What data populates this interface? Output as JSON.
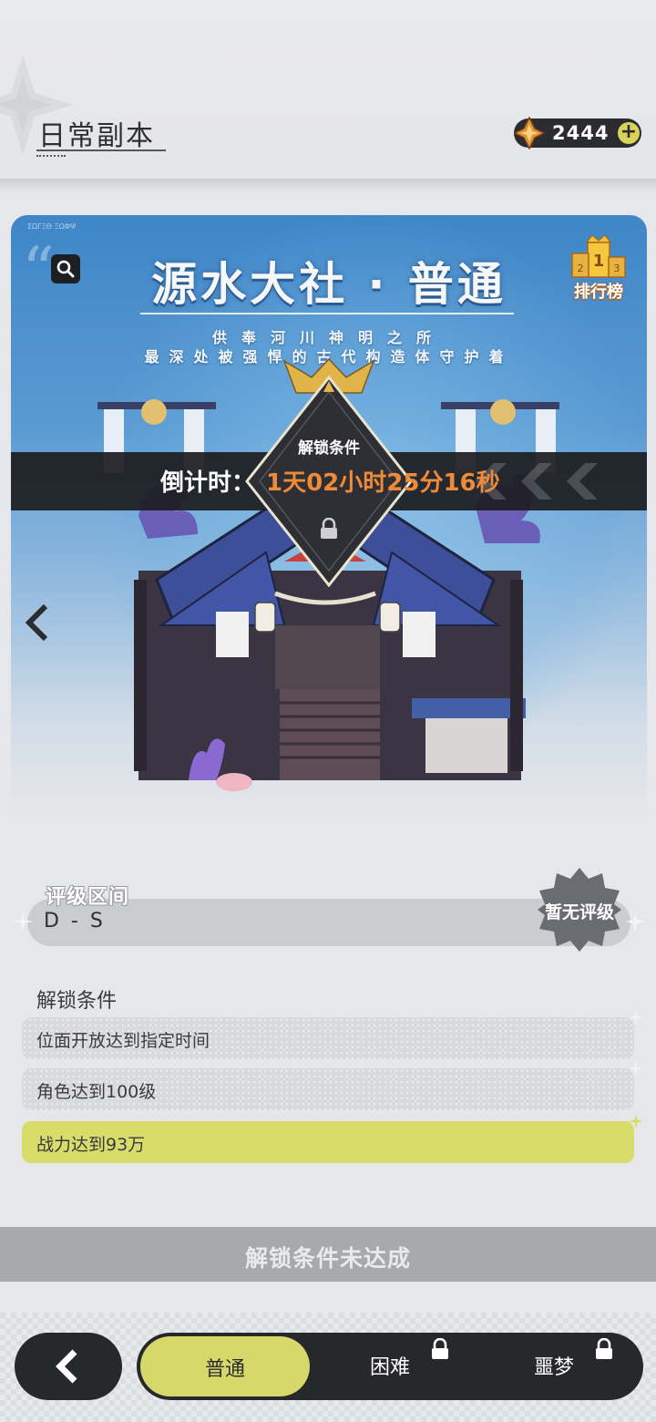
{
  "header": {
    "title": "日常副本",
    "currency": {
      "value": "2444",
      "icon": "crystal-icon",
      "add_icon": "plus-icon"
    }
  },
  "stage": {
    "title": "源水大社 · 普通",
    "subtitle_line1": "供奉河川神明之所",
    "subtitle_line2": "最深处被强悍的古代构造体守护着",
    "corner_mark": "ΣΩΓΞΘ ΞΩΦΨ",
    "ranking_label": "排行榜",
    "unlock_tag": "解锁条件",
    "countdown_label": "倒计时：",
    "countdown_value": "1天02小时25分16秒"
  },
  "rating": {
    "label": "评级区间",
    "range": "D - S",
    "badge": "暂无评级"
  },
  "unlock": {
    "heading": "解锁条件",
    "conditions": [
      {
        "text": "位面开放达到指定时间",
        "met": false
      },
      {
        "text": "角色达到100级",
        "met": false
      },
      {
        "text": "战力达到93万",
        "met": true
      }
    ],
    "status": "解锁条件未达成"
  },
  "nav": {
    "tabs": [
      {
        "label": "普通",
        "active": true,
        "locked": false
      },
      {
        "label": "困难",
        "active": false,
        "locked": true
      },
      {
        "label": "噩梦",
        "active": false,
        "locked": true
      }
    ]
  },
  "colors": {
    "accent_yellow": "#d6d86a",
    "countdown_orange": "#ef8a3a",
    "dark": "#27282c",
    "banner_blue": "#3f86c8"
  }
}
